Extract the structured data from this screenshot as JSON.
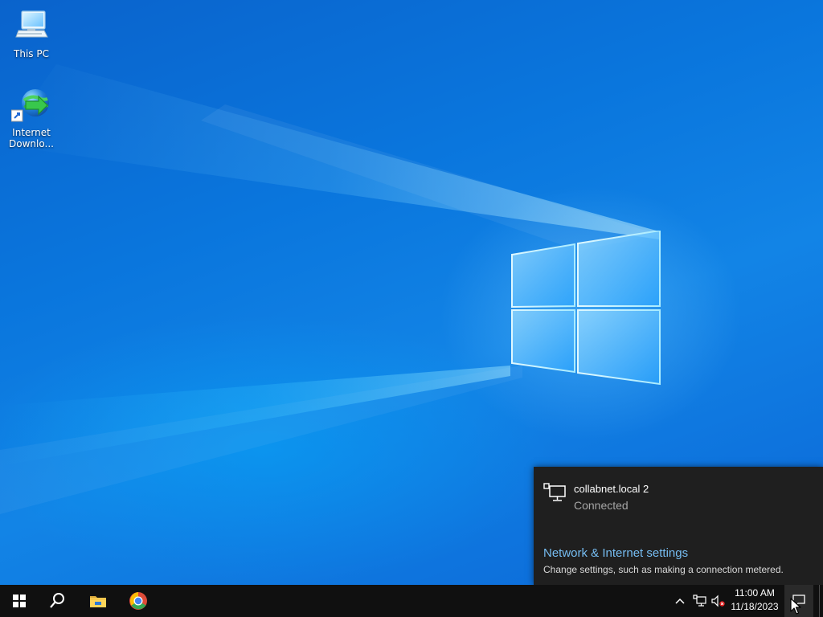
{
  "desktop": {
    "icons": [
      {
        "label": "This PC",
        "icon": "computer-icon"
      },
      {
        "label": "Internet\nDownlo...",
        "icon": "internet-download-manager-icon"
      }
    ]
  },
  "notification": {
    "network_name": "collabnet.local 2",
    "network_status": "Connected",
    "settings_link": "Network & Internet settings",
    "settings_desc": "Change settings, such as making a connection metered."
  },
  "taskbar": {
    "buttons": [
      {
        "icon": "windows-start-icon"
      },
      {
        "icon": "search-icon"
      },
      {
        "icon": "file-explorer-icon"
      },
      {
        "icon": "chrome-icon"
      }
    ],
    "tray": {
      "icons": [
        "chevron-up-icon",
        "network-icon",
        "volume-muted-icon"
      ],
      "time": "11:00 AM",
      "date": "11/18/2023"
    }
  },
  "colors": {
    "taskbar_bg": "#101010",
    "flyout_bg": "#1f1f1f",
    "link_blue": "#76bdf2",
    "desktop_blue": "#0b77dd"
  }
}
